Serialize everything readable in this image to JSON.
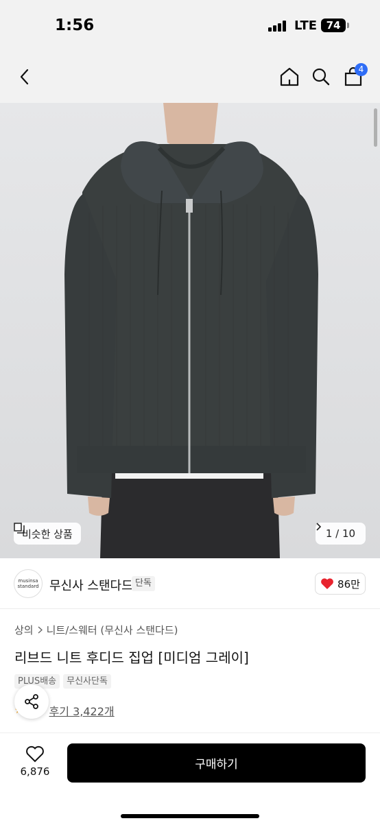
{
  "status_bar": {
    "time": "1:56",
    "network": "LTE",
    "battery": "74"
  },
  "nav": {
    "cart_count": "4",
    "icons": [
      "back-icon",
      "home-icon",
      "search-icon",
      "bag-icon"
    ]
  },
  "hero": {
    "similar_label": "비슷한 상품",
    "counter": "1 / 10"
  },
  "brand": {
    "logo_line1": "musinsa",
    "logo_line2": "standard",
    "name": "무신사 스탠다드",
    "tag": "단독",
    "likes": "86만"
  },
  "product": {
    "breadcrumb": [
      "상의",
      "니트/스웨터 (무신사 스탠다드)"
    ],
    "title": "리브드 니트 후디드 집업 [미디엄 그레이]",
    "tags": [
      "PLUS배송",
      "무신사단독"
    ],
    "review": "후기 3,422개"
  },
  "bottom": {
    "wish_count": "6,876",
    "buy_label": "구매하기"
  },
  "colors": {
    "accent_badge": "#2f6df6",
    "heart": "#e8232e",
    "buy_button": "#000000",
    "garment": "#3a3f3f"
  }
}
